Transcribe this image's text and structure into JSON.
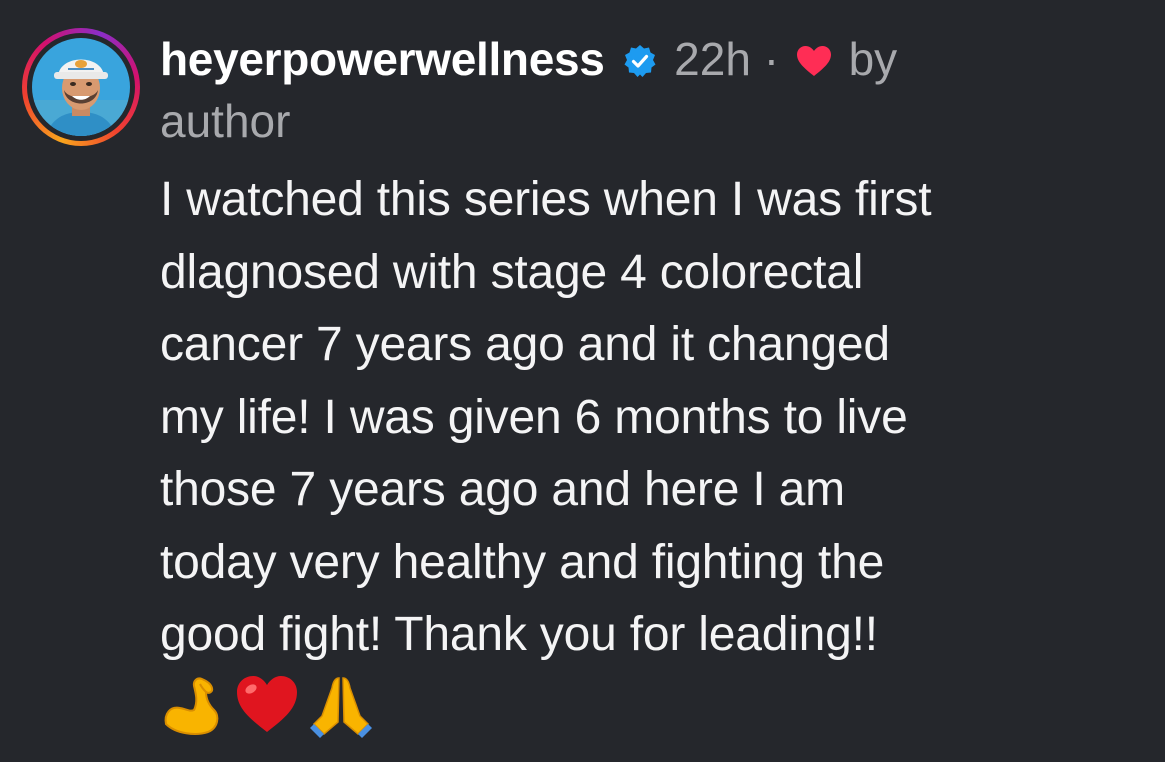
{
  "comment": {
    "username": "heyerpowerwellness",
    "verified_icon": "verified-badge-icon",
    "time_ago": "22h",
    "separator": "·",
    "liked_by_label": "by",
    "liked_by_who": "author",
    "heart_color": "#ff2d55",
    "text_lines": [
      "I watched this series when I was first",
      "dlagnosed with stage 4 colorectal",
      "cancer 7 years ago and it changed",
      "my life! I was given 6 months to live",
      "those 7 years ago and here I am",
      "today very healthy and fighting the",
      "good fight! Thank you for leading!!"
    ],
    "emojis": [
      "flexed-biceps-emoji",
      "red-heart-emoji",
      "folded-hands-emoji"
    ]
  }
}
